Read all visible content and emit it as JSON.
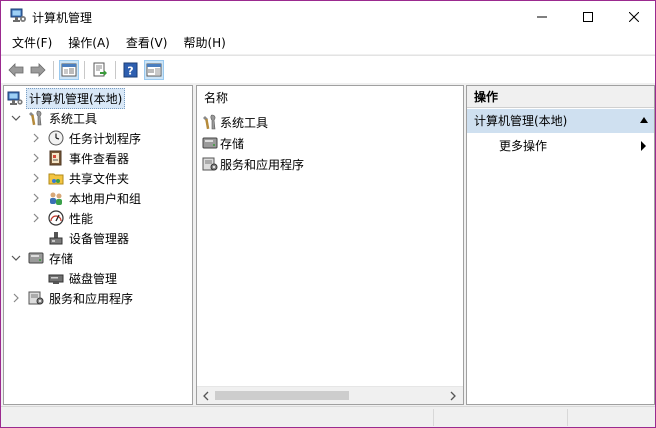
{
  "window": {
    "title": "计算机管理",
    "accent_border": "#9b2a8f"
  },
  "menu": [
    {
      "label": "文件(F)"
    },
    {
      "label": "操作(A)"
    },
    {
      "label": "查看(V)"
    },
    {
      "label": "帮助(H)"
    }
  ],
  "toolbar": {
    "buttons": [
      "back-arrow-icon",
      "forward-arrow-icon",
      "show-hide-console-tree-icon",
      "export-list-icon",
      "help-icon",
      "show-hide-action-pane-icon"
    ]
  },
  "tree": {
    "root": {
      "label": "计算机管理(本地)"
    },
    "items": [
      {
        "label": "系统工具",
        "level": 1,
        "expanded": true
      },
      {
        "label": "任务计划程序",
        "level": 2
      },
      {
        "label": "事件查看器",
        "level": 2
      },
      {
        "label": "共享文件夹",
        "level": 2
      },
      {
        "label": "本地用户和组",
        "level": 2
      },
      {
        "label": "性能",
        "level": 2
      },
      {
        "label": "设备管理器",
        "level": 2
      },
      {
        "label": "存储",
        "level": 1,
        "expanded": true
      },
      {
        "label": "磁盘管理",
        "level": 2
      },
      {
        "label": "服务和应用程序",
        "level": 1,
        "expanded": false
      }
    ]
  },
  "list": {
    "column_header": "名称",
    "rows": [
      {
        "label": "系统工具"
      },
      {
        "label": "存储"
      },
      {
        "label": "服务和应用程序"
      }
    ]
  },
  "actions": {
    "header": "操作",
    "section_title": "计算机管理(本地)",
    "items": [
      {
        "label": "更多操作"
      }
    ]
  }
}
